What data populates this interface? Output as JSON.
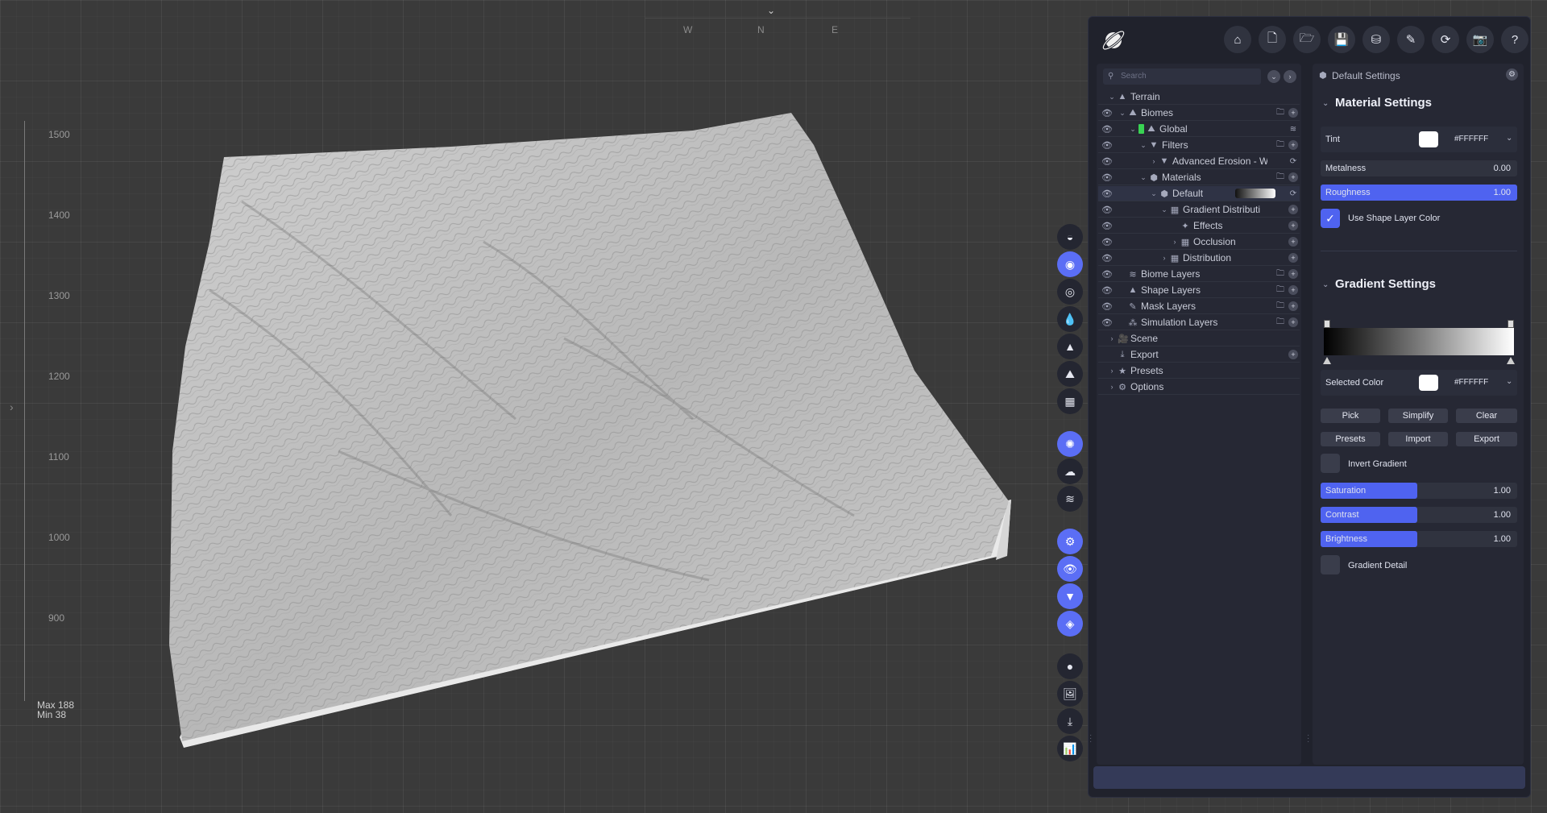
{
  "viewport": {
    "compass": [
      "W",
      "N",
      "E"
    ],
    "ruler_labels": [
      "1500",
      "1400",
      "1300",
      "1200",
      "1100",
      "1000",
      "900"
    ],
    "max_label": "Max 188",
    "min_label": "Min 38"
  },
  "toolbar": {
    "buttons": [
      {
        "icon": "home-icon",
        "glyph": "⌂"
      },
      {
        "icon": "new-file-icon",
        "glyph": "🗋"
      },
      {
        "icon": "open-folder-icon",
        "glyph": "🗁"
      },
      {
        "icon": "save-icon",
        "glyph": "💾"
      },
      {
        "icon": "save-as-icon",
        "glyph": "⛁"
      },
      {
        "icon": "export-file-icon",
        "glyph": "✎"
      },
      {
        "icon": "refresh-icon",
        "glyph": "⟳"
      },
      {
        "icon": "camera-icon",
        "glyph": "📷"
      },
      {
        "icon": "help-icon",
        "glyph": "?"
      }
    ]
  },
  "tree": {
    "search_placeholder": "Search",
    "rows": [
      {
        "label": "Terrain",
        "indent": 0,
        "eye": false,
        "chev": "v",
        "icon": "▲",
        "actions": []
      },
      {
        "label": "Biomes",
        "indent": 1,
        "eye": true,
        "chev": "v",
        "icon": "⛰",
        "actions": [
          "folder",
          "plus"
        ]
      },
      {
        "label": "Global",
        "indent": 2,
        "eye": true,
        "chev": "v",
        "icon": "⛰",
        "green": true,
        "actions": [
          "layers"
        ]
      },
      {
        "label": "Filters",
        "indent": 3,
        "eye": true,
        "chev": "v",
        "icon": "▼",
        "actions": [
          "folder",
          "plus"
        ]
      },
      {
        "label": "Advanced Erosion - W",
        "indent": 4,
        "eye": true,
        "chev": ">",
        "icon": "▼",
        "actions": [
          "sync"
        ]
      },
      {
        "label": "Materials",
        "indent": 3,
        "eye": true,
        "chev": "v",
        "icon": "⬢",
        "actions": [
          "folder",
          "plus"
        ]
      },
      {
        "label": "Default",
        "indent": 4,
        "eye": true,
        "chev": "v",
        "icon": "⬢",
        "gradient": true,
        "selected": true,
        "actions": [
          "sync"
        ]
      },
      {
        "label": "Gradient Distributi",
        "indent": 5,
        "eye": true,
        "chev": "v",
        "icon": "▦",
        "actions": [
          "plus"
        ]
      },
      {
        "label": "Effects",
        "indent": 6,
        "eye": true,
        "chev": "",
        "icon": "✦",
        "actions": [
          "plus"
        ]
      },
      {
        "label": "Occlusion",
        "indent": 6,
        "eye": true,
        "chev": ">",
        "icon": "▦",
        "actions": [
          "plus"
        ]
      },
      {
        "label": "Distribution",
        "indent": 5,
        "eye": true,
        "chev": ">",
        "icon": "▦",
        "actions": [
          "plus"
        ]
      },
      {
        "label": "Biome Layers",
        "indent": 1,
        "eye": true,
        "chev": "",
        "icon": "≋",
        "actions": [
          "folder",
          "plus"
        ]
      },
      {
        "label": "Shape Layers",
        "indent": 1,
        "eye": true,
        "chev": "",
        "icon": "▲",
        "actions": [
          "folder",
          "plus"
        ]
      },
      {
        "label": "Mask Layers",
        "indent": 1,
        "eye": true,
        "chev": "",
        "icon": "✎",
        "actions": [
          "folder",
          "plus"
        ]
      },
      {
        "label": "Simulation Layers",
        "indent": 1,
        "eye": true,
        "chev": "",
        "icon": "⁂",
        "actions": [
          "folder",
          "plus"
        ]
      },
      {
        "label": "Scene",
        "indent": 0,
        "eye": false,
        "chev": ">",
        "icon": "🎥",
        "actions": []
      },
      {
        "label": "Export",
        "indent": 0,
        "eye": false,
        "chev": "",
        "icon": "⤓",
        "actions": [
          "plus"
        ]
      },
      {
        "label": "Presets",
        "indent": 0,
        "eye": false,
        "chev": ">",
        "icon": "★",
        "actions": []
      },
      {
        "label": "Options",
        "indent": 0,
        "eye": false,
        "chev": ">",
        "icon": "⚙",
        "actions": []
      }
    ]
  },
  "settings": {
    "header": "Default Settings",
    "material_title": "Material Settings",
    "tint_label": "Tint",
    "tint_hex": "#FFFFFF",
    "metalness_label": "Metalness",
    "metalness_value": "0.00",
    "metalness_fraction": 0.0,
    "roughness_label": "Roughness",
    "roughness_value": "1.00",
    "roughness_fraction": 1.0,
    "use_shape_color_label": "Use Shape Layer Color",
    "gradient_title": "Gradient Settings",
    "selected_color_label": "Selected Color",
    "selected_color_hex": "#FFFFFF",
    "buttons_row1": [
      "Pick",
      "Simplify",
      "Clear"
    ],
    "buttons_row2": [
      "Presets",
      "Import",
      "Export"
    ],
    "invert_label": "Invert Gradient",
    "saturation_label": "Saturation",
    "saturation_value": "1.00",
    "contrast_label": "Contrast",
    "contrast_value": "1.00",
    "brightness_label": "Brightness",
    "brightness_value": "1.00",
    "gradient_detail_label": "Gradient Detail"
  },
  "colors": {
    "accent": "#5b6ef5",
    "panel_bg": "#20222c",
    "green": "#39d353"
  }
}
